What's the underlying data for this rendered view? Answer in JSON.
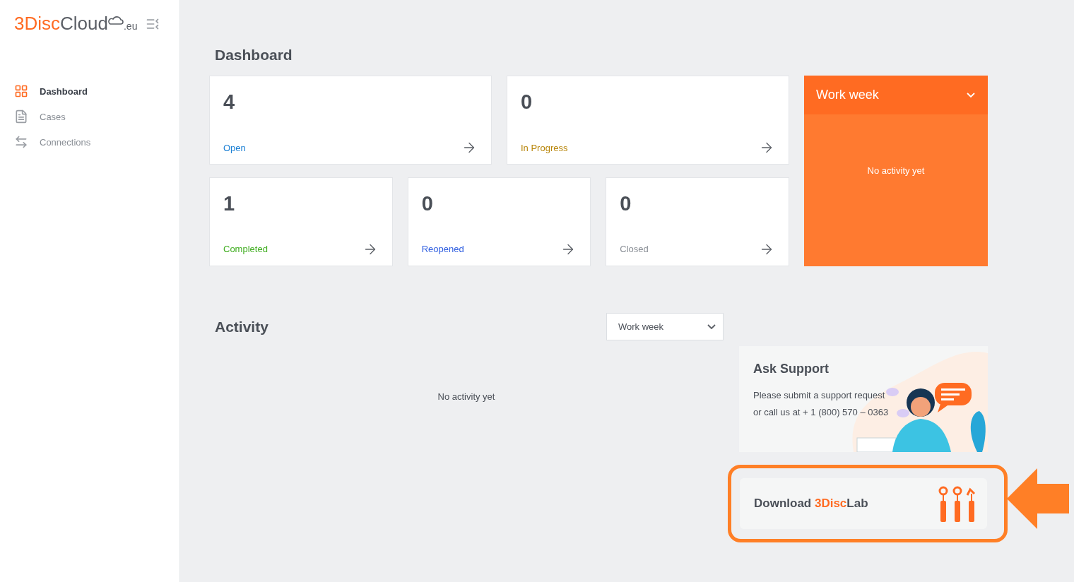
{
  "logo": {
    "brand_part": "3Disc",
    "rest_part": "Cloud",
    "suffix": ".eu"
  },
  "sidebar": {
    "items": [
      {
        "label": "Dashboard",
        "selected": true
      },
      {
        "label": "Cases",
        "selected": false
      },
      {
        "label": "Connections",
        "selected": false
      }
    ]
  },
  "dashboard": {
    "title": "Dashboard",
    "stats": [
      {
        "count": "4",
        "label": "Open",
        "color": "#1a7fd4"
      },
      {
        "count": "0",
        "label": "In Progress",
        "color": "#b8860b"
      },
      {
        "count": "1",
        "label": "Completed",
        "color": "#3fad1f"
      },
      {
        "count": "0",
        "label": "Reopened",
        "color": "#2f5ee0"
      },
      {
        "count": "0",
        "label": "Closed",
        "color": "#8a8f96"
      }
    ],
    "work_week": {
      "title": "Work week",
      "message": "No activity yet"
    }
  },
  "activity": {
    "title": "Activity",
    "period": "Work week",
    "message": "No activity yet"
  },
  "support": {
    "title": "Ask Support",
    "text_line_1": "Please submit a support request",
    "text_line_2": "or call us at + 1 (800) 570 – 0363"
  },
  "download": {
    "prefix": "Download ",
    "brand_part": "3Disc",
    "rest_part": "Lab",
    "highlighted": true
  }
}
